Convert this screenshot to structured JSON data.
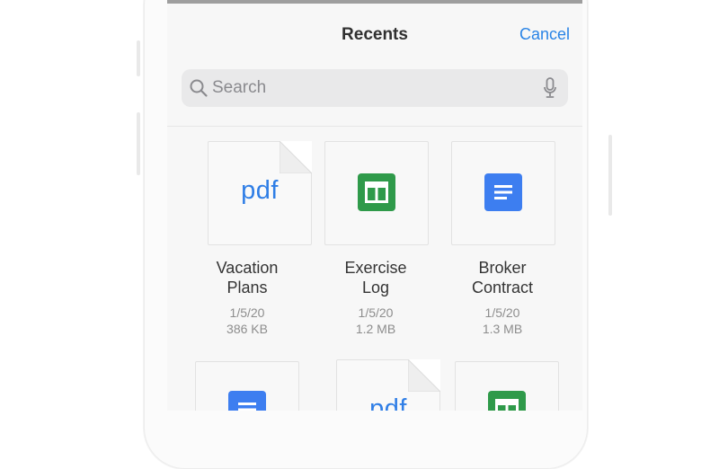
{
  "header": {
    "title": "Recents",
    "cancel_label": "Cancel"
  },
  "search": {
    "placeholder": "Search"
  },
  "files": [
    {
      "type": "pdf",
      "icon": "pdf-file-icon",
      "thumb_text": "pdf",
      "name_lines": [
        "Vacation",
        "Plans"
      ],
      "date": "1/5/20",
      "size": "386 KB"
    },
    {
      "type": "sheet",
      "icon": "spreadsheet-icon",
      "name_lines": [
        "Exercise",
        "Log"
      ],
      "date": "1/5/20",
      "size": "1.2 MB"
    },
    {
      "type": "doc",
      "icon": "document-icon",
      "name_lines": [
        "Broker",
        "Contract"
      ],
      "date": "1/5/20",
      "size": "1.3 MB"
    },
    {
      "type": "doc",
      "icon": "document-icon"
    },
    {
      "type": "pdf",
      "icon": "pdf-file-icon",
      "thumb_text": "pdf"
    },
    {
      "type": "sheet",
      "icon": "spreadsheet-icon"
    }
  ],
  "colors": {
    "accent": "#2a84e6",
    "doc_blue": "#3d7ef0",
    "sheet_green": "#2f9a4a",
    "pdf_blue": "#2f7ee6"
  }
}
